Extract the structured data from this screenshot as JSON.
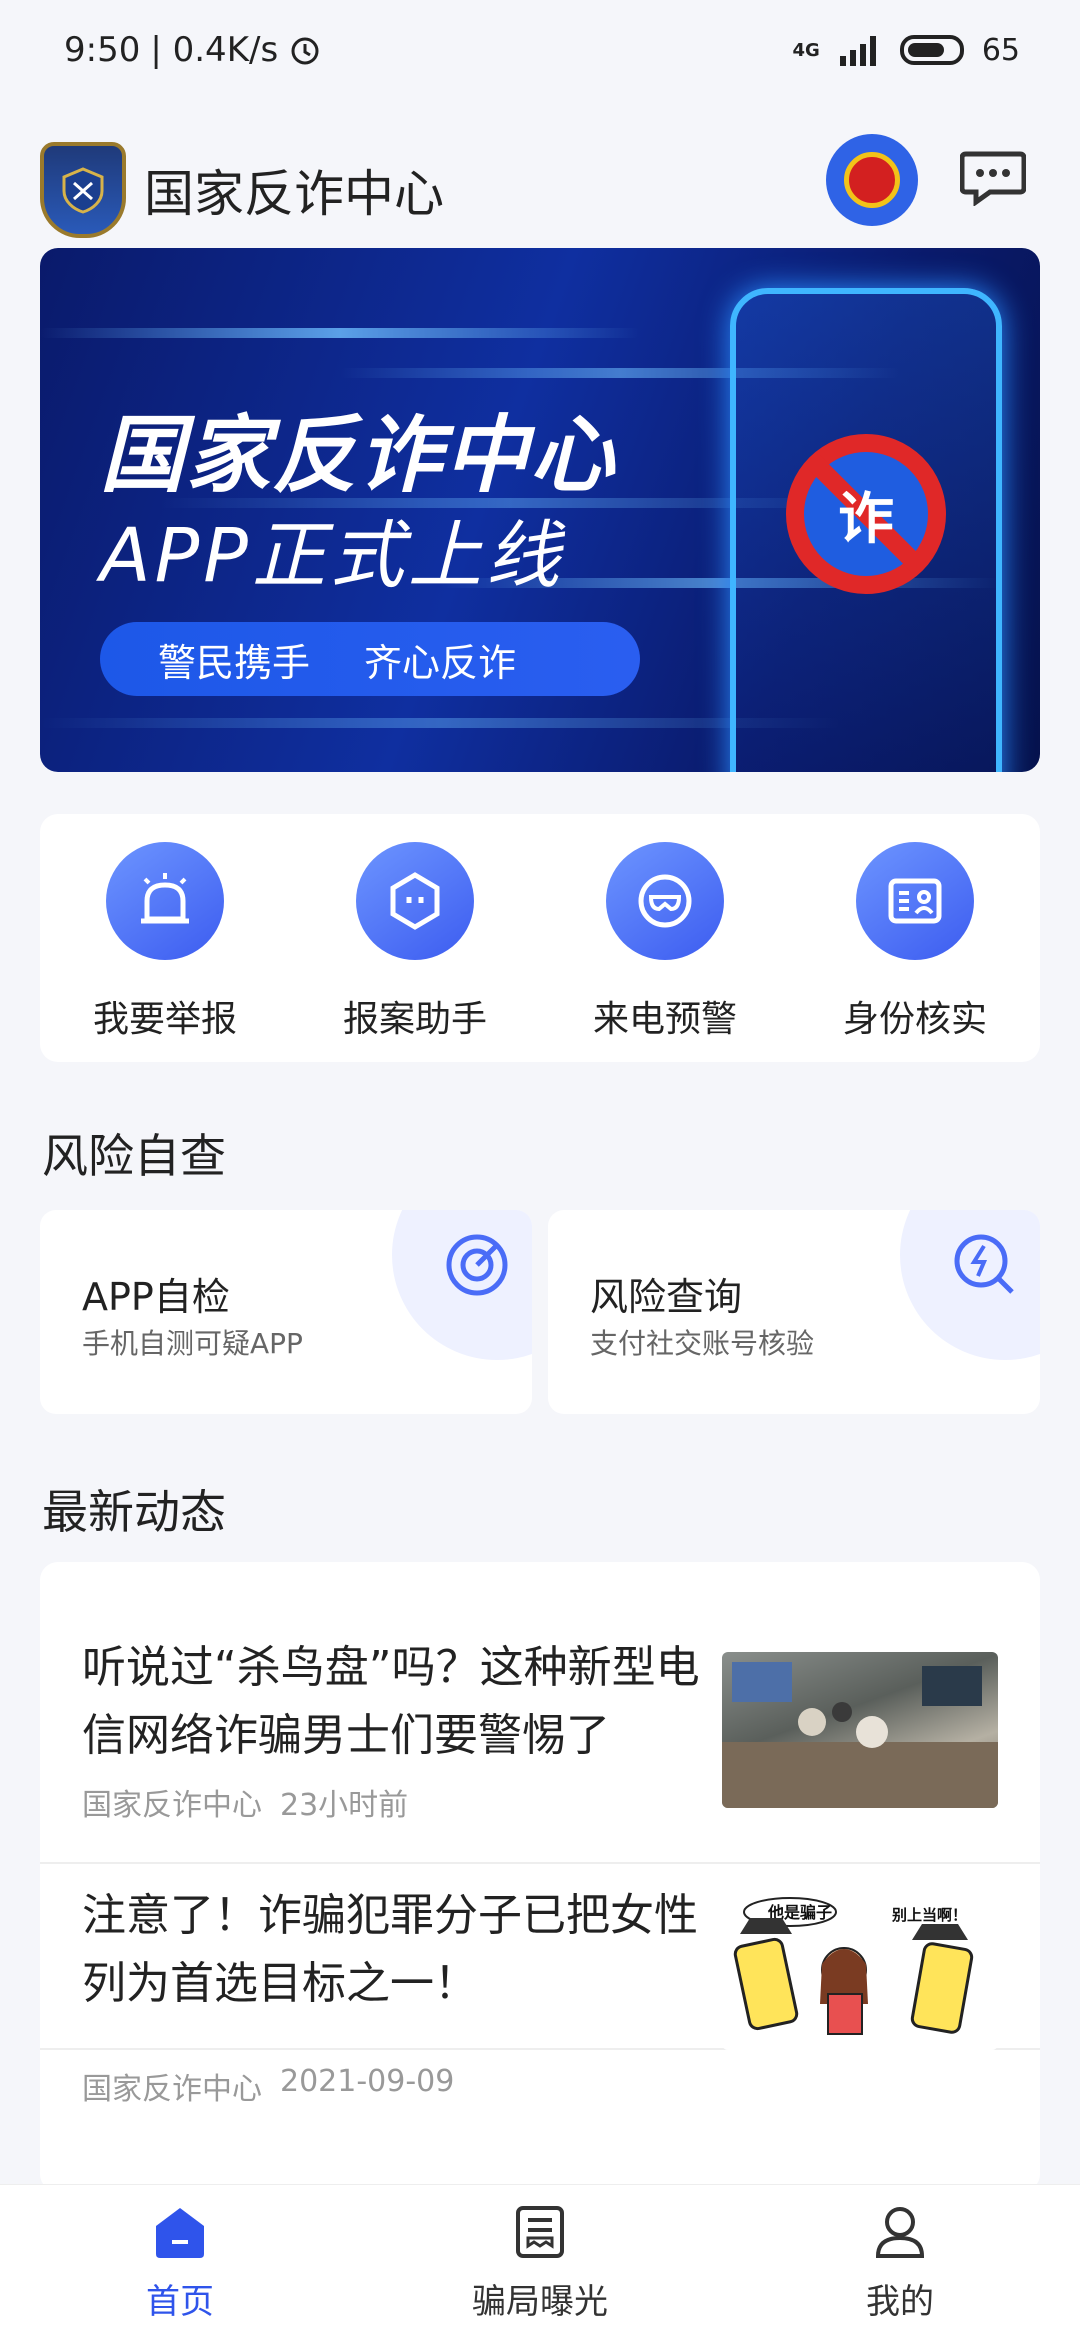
{
  "status_bar": {
    "time": "9:50",
    "speed": "| 0.4K/s",
    "network": "4G",
    "battery": "65"
  },
  "header": {
    "title": "国家反诈中心"
  },
  "banner": {
    "title": "国家反诈中心",
    "subtitle": "APP正式上线",
    "slogan_1": "警民携手",
    "slogan_2": "齐心反诈",
    "badge_char": "诈"
  },
  "quick_actions": [
    {
      "label": "我要举报",
      "icon": "alarm-icon"
    },
    {
      "label": "报案助手",
      "icon": "hexagon-face-icon"
    },
    {
      "label": "来电预警",
      "icon": "mask-icon"
    },
    {
      "label": "身份核实",
      "icon": "id-card-icon"
    }
  ],
  "risk_section": {
    "title": "风险自查",
    "cards": [
      {
        "title": "APP自检",
        "subtitle": "手机自测可疑APP",
        "icon": "target-icon"
      },
      {
        "title": "风险查询",
        "subtitle": "支付社交账号核验",
        "icon": "lightning-search-icon"
      }
    ]
  },
  "news_section": {
    "title": "最新动态",
    "items": [
      {
        "title": "听说过“杀鸟盘”吗？这种新型电信网络诈骗男士们要警惕了",
        "source": "国家反诈中心",
        "time": "23小时前"
      },
      {
        "title": "注意了！诈骗犯罪分子已把女性列为首选目标之一！",
        "source": "国家反诈中心",
        "time": "2021-09-09",
        "thumb_text_1": "他是骗子",
        "thumb_text_2": "别上当啊！"
      }
    ]
  },
  "tabbar": {
    "items": [
      {
        "label": "首页",
        "icon": "home-icon",
        "active": true
      },
      {
        "label": "骗局曝光",
        "icon": "document-icon",
        "active": false
      },
      {
        "label": "我的",
        "icon": "user-icon",
        "active": false
      }
    ]
  },
  "colors": {
    "accent": "#2f54eb",
    "banner_dark": "#0a1a6b",
    "alert_red": "#e02828"
  }
}
